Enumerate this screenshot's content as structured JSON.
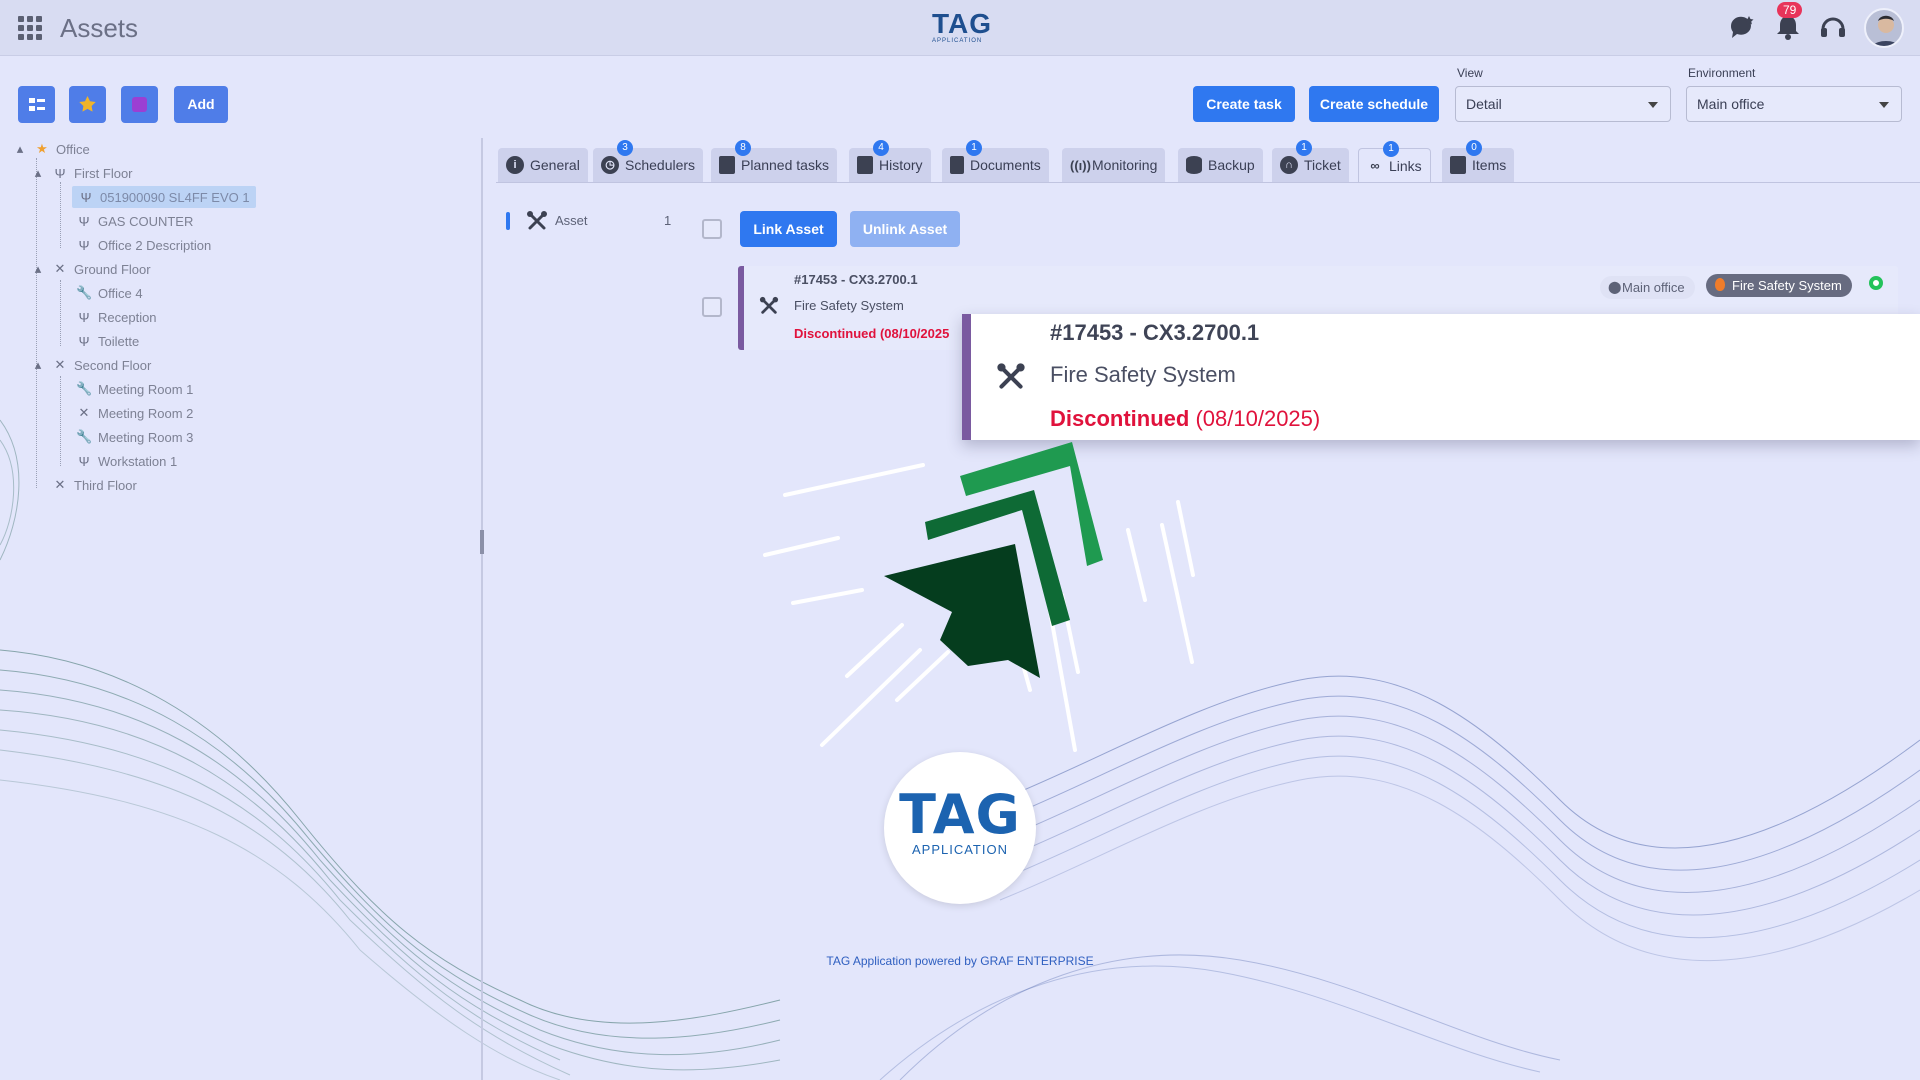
{
  "header": {
    "app_title": "Assets",
    "brand_big": "TAG",
    "brand_small": "APPLICATION",
    "notifications_count": "79"
  },
  "toolbar": {
    "add_label": "Add",
    "create_task_label": "Create task",
    "create_schedule_label": "Create schedule"
  },
  "view": {
    "label": "View",
    "value": "Detail"
  },
  "environment": {
    "label": "Environment",
    "value": "Main office"
  },
  "tree": {
    "root": "Office",
    "first_floor": "First Floor",
    "item_selected": "051900090 SL4FF EVO 1",
    "gas_counter": "GAS COUNTER",
    "office2": "Office 2 Description",
    "ground_floor": "Ground Floor",
    "office4": "Office 4",
    "reception": "Reception",
    "toilette": "Toilette",
    "second_floor": "Second Floor",
    "meeting1": "Meeting Room 1",
    "meeting2": "Meeting Room 2",
    "meeting3": "Meeting Room 3",
    "workstation1": "Workstation 1",
    "third_floor": "Third Floor"
  },
  "tabs": [
    {
      "label": "General",
      "badge": ""
    },
    {
      "label": "Schedulers",
      "badge": "3"
    },
    {
      "label": "Planned tasks",
      "badge": "8"
    },
    {
      "label": "History",
      "badge": "4"
    },
    {
      "label": "Documents",
      "badge": "1"
    },
    {
      "label": "Monitoring",
      "badge": ""
    },
    {
      "label": "Backup",
      "badge": ""
    },
    {
      "label": "Ticket",
      "badge": "1"
    },
    {
      "label": "Links",
      "badge": "1"
    },
    {
      "label": "Items",
      "badge": "0"
    }
  ],
  "links": {
    "asset_label": "Asset",
    "asset_count": "1",
    "link_label": "Link Asset",
    "unlink_label": "Unlink Asset"
  },
  "card": {
    "title": "#17453 - CX3.2700.1",
    "subtitle": "Fire Safety System",
    "status_word": "Discontinued",
    "status_date": "(08/10/2025)",
    "status_full": "Discontinued (08/10/2025",
    "location": "Main office",
    "category": "Fire Safety System"
  },
  "logo": {
    "big": "TAG",
    "small": "APPLICATION"
  },
  "footer": {
    "powered": "TAG Application powered by GRAF ENTERPRISE"
  },
  "colors": {
    "accent": "#2f78f0",
    "status_red": "#e0123c",
    "card_border": "#7a5aa0",
    "arrow_dark": "#053d1e",
    "arrow_mid": "#0e6a35",
    "arrow_light": "#1f9a50"
  }
}
